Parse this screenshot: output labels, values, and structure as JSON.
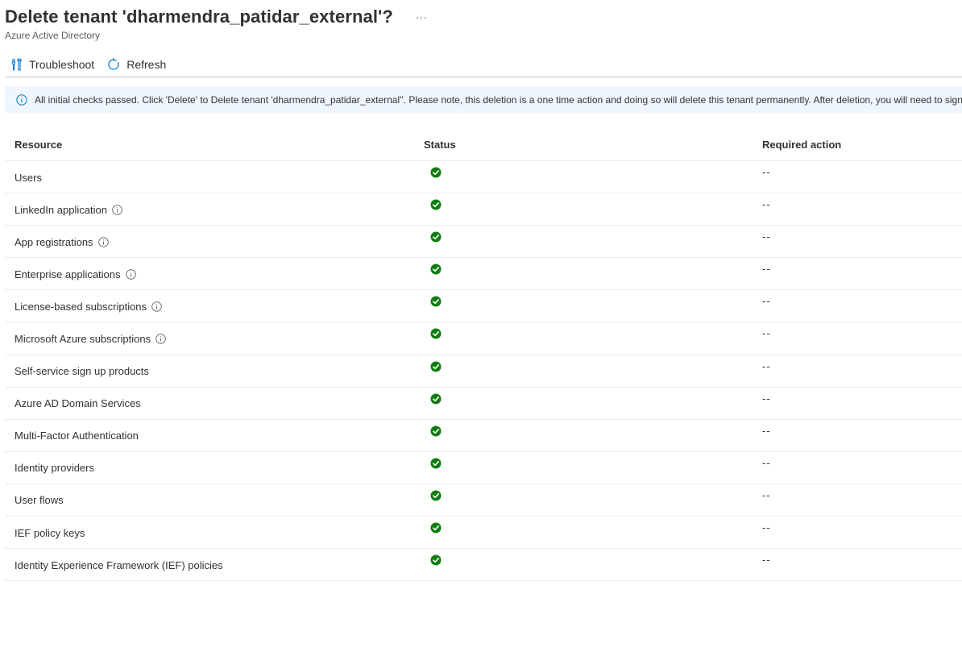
{
  "header": {
    "title": "Delete tenant 'dharmendra_patidar_external'?",
    "more": "···",
    "subtitle": "Azure Active Directory"
  },
  "toolbar": {
    "troubleshoot_label": "Troubleshoot",
    "troubleshoot_icon": "wrench-icon",
    "refresh_label": "Refresh",
    "refresh_icon": "refresh-icon"
  },
  "info": {
    "icon": "info-icon",
    "text": "All initial checks passed. Click 'Delete' to Delete tenant 'dharmendra_patidar_external''. Please note, this deletion is a one time action and doing so will delete this tenant permanently. After deletion, you will need to sign"
  },
  "table": {
    "columns": [
      "Resource",
      "Status",
      "Required action"
    ],
    "rows": [
      {
        "resource": "Users",
        "info": false,
        "status": "success",
        "action": "--"
      },
      {
        "resource": "LinkedIn application",
        "info": true,
        "status": "success",
        "action": "--"
      },
      {
        "resource": "App registrations",
        "info": true,
        "status": "success",
        "action": "--"
      },
      {
        "resource": "Enterprise applications",
        "info": true,
        "status": "success",
        "action": "--"
      },
      {
        "resource": "License-based subscriptions",
        "info": true,
        "status": "success",
        "action": "--"
      },
      {
        "resource": "Microsoft Azure subscriptions",
        "info": true,
        "status": "success",
        "action": "--"
      },
      {
        "resource": "Self-service sign up products",
        "info": false,
        "status": "success",
        "action": "--"
      },
      {
        "resource": "Azure AD Domain Services",
        "info": false,
        "status": "success",
        "action": "--"
      },
      {
        "resource": "Multi-Factor Authentication",
        "info": false,
        "status": "success",
        "action": "--"
      },
      {
        "resource": "Identity providers",
        "info": false,
        "status": "success",
        "action": "--"
      },
      {
        "resource": "User flows",
        "info": false,
        "status": "success",
        "action": "--"
      },
      {
        "resource": "IEF policy keys",
        "info": false,
        "status": "success",
        "action": "--"
      },
      {
        "resource": "Identity Experience Framework (IEF) policies",
        "info": false,
        "status": "success",
        "action": "--"
      }
    ]
  },
  "colors": {
    "accent": "#0078d4",
    "success": "#107c10",
    "info_bg": "#f0f6ff"
  }
}
